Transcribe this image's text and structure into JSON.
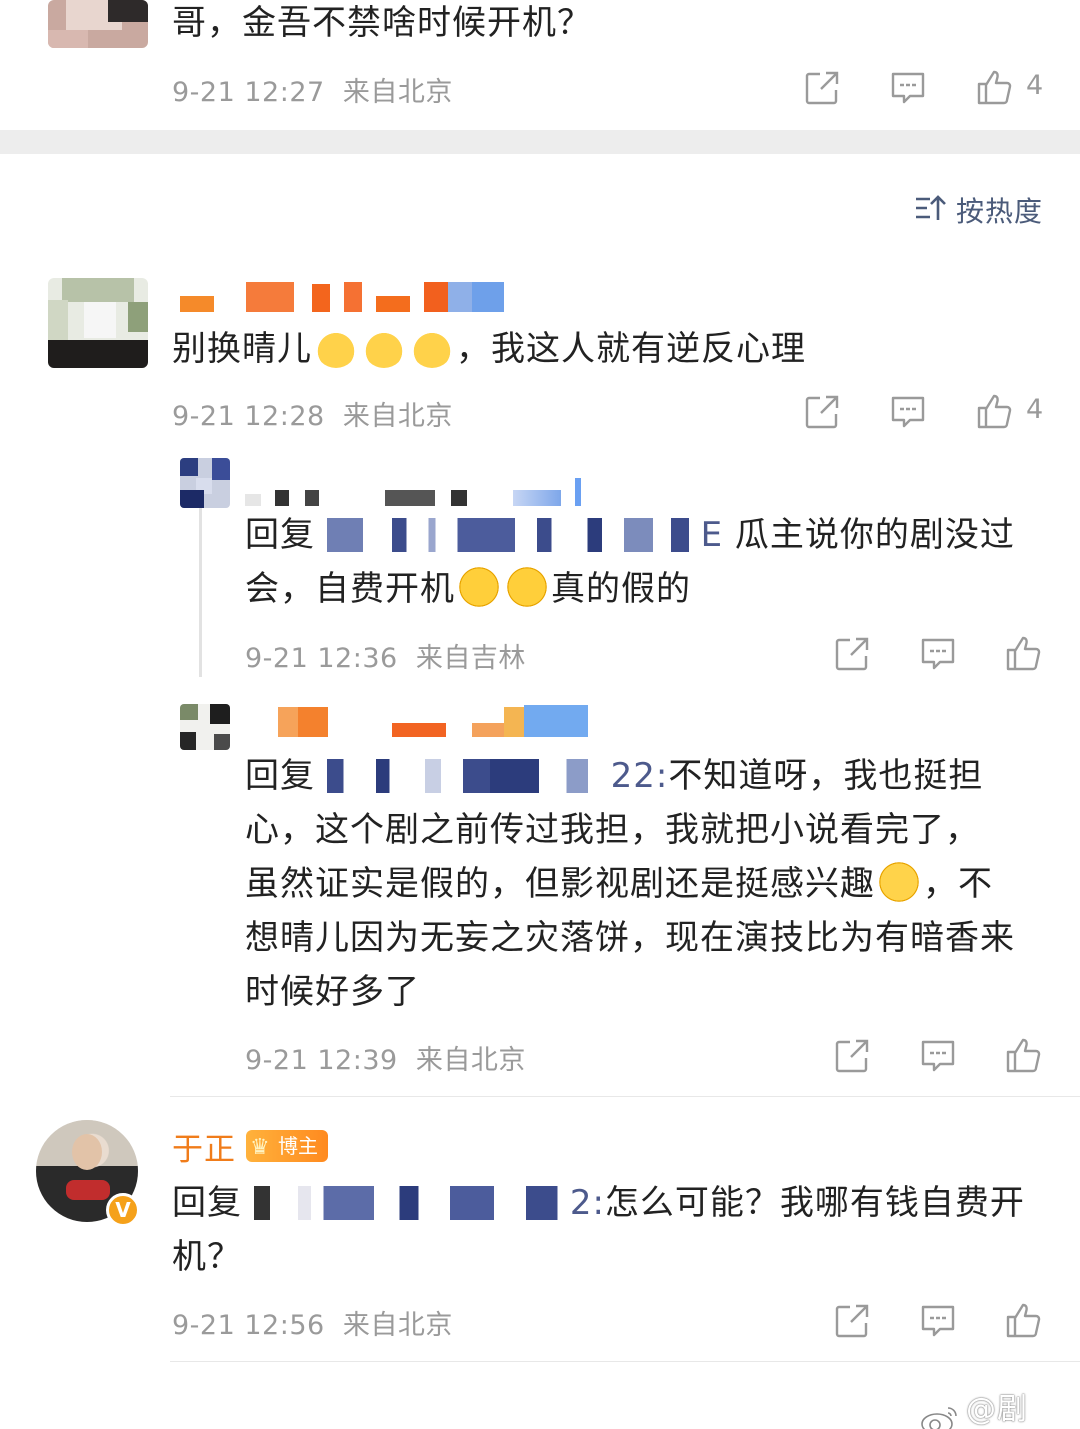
{
  "top_comment": {
    "text": "哥，金吾不禁啥时候开机？",
    "date": "9-21 12:27",
    "location": "来自北京",
    "like_count": "4"
  },
  "sort": {
    "icon": "sort-hot-icon",
    "label": "按热度"
  },
  "comment_1": {
    "text_before_emoji": "别换晴儿",
    "emoji": "angel-emoji",
    "text_after_emoji": "，我这人就有逆反心理",
    "date": "9-21 12:28",
    "location": "来自北京",
    "like_count": "4"
  },
  "reply_1": {
    "prefix": "回复",
    "mention_suffix": "E",
    "text_line1": "瓜主说你的剧没过",
    "text_line2a": "会，自费开机",
    "emoji": "crying-laughing-emoji",
    "text_line2b": "真的假的",
    "date": "9-21 12:36",
    "location": "来自吉林"
  },
  "reply_2": {
    "prefix": "回复",
    "mention_suffix": "22:",
    "text_line1": "不知道呀，我也挺担",
    "text_line2": "心，这个剧之前传过我担，我就把小说看完了，",
    "text_line3a": "虽然证实是假的，但影视剧还是挺感兴趣",
    "emoji": "worried-emoji",
    "text_line3b": "，不",
    "text_line4": "想晴儿因为无妄之灾落饼，现在演技比为有暗香来",
    "text_line5": "时候好多了",
    "date": "9-21 12:39",
    "location": "来自北京"
  },
  "comment_author": {
    "name": "于正",
    "badge": "博主",
    "verify_mark": "V",
    "prefix": "回复",
    "mention_suffix": "2:",
    "text_line1": "怎么可能？我哪有钱自费开",
    "text_line2": "机？",
    "date": "9-21 12:56",
    "location": "来自北京"
  },
  "watermark": "@剧MM",
  "colors": {
    "meta_gray": "#9a9a9a",
    "link_blue": "#4d5a8c",
    "author_orange": "#f07c1a",
    "divider": "#ededed"
  }
}
